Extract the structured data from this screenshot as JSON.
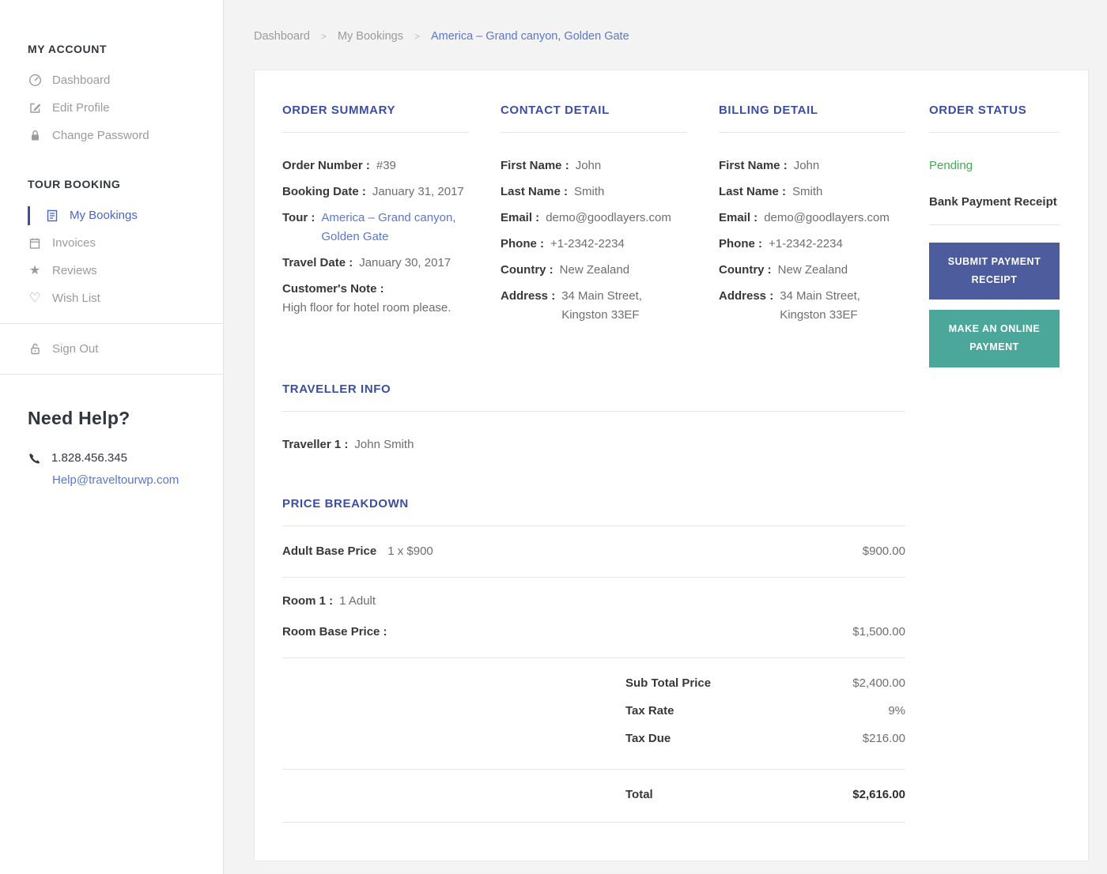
{
  "colors": {
    "heading_blue": "#3c4f9e",
    "link_blue": "#5c77ca",
    "pending_green": "#3faf4d",
    "submit_button_bg": "#4d5c9d",
    "online_button_bg": "#4ca79b"
  },
  "sidebar": {
    "account": {
      "title": "MY ACCOUNT",
      "items": [
        {
          "label": "Dashboard",
          "icon": "dashboard-icon"
        },
        {
          "label": "Edit Profile",
          "icon": "edit-icon"
        },
        {
          "label": "Change Password",
          "icon": "lock-icon"
        }
      ]
    },
    "booking": {
      "title": "TOUR BOOKING",
      "items": [
        {
          "label": "My Bookings",
          "icon": "bookings-icon",
          "active": true
        },
        {
          "label": "Invoices",
          "icon": "invoice-icon"
        },
        {
          "label": "Reviews",
          "icon": "star-icon"
        },
        {
          "label": "Wish List",
          "icon": "heart-icon"
        }
      ]
    },
    "sign_out": "Sign Out",
    "help": {
      "title": "Need Help?",
      "phone": "1.828.456.345",
      "email": "Help@traveltourwp.com"
    }
  },
  "breadcrumb": {
    "home": "Dashboard",
    "section": "My Bookings",
    "current": "America – Grand canyon, Golden Gate",
    "separator": ">"
  },
  "order_summary": {
    "title": "ORDER SUMMARY",
    "order_number_label": "Order Number :",
    "order_number": "#39",
    "booking_date_label": "Booking Date :",
    "booking_date": "January 31, 2017",
    "tour_label": "Tour :",
    "tour": "America – Grand canyon, Golden Gate",
    "travel_date_label": "Travel Date :",
    "travel_date": "January 30, 2017",
    "note_label": "Customer's Note :",
    "note": "High floor for hotel room please."
  },
  "contact_detail": {
    "title": "CONTACT DETAIL",
    "fields": [
      {
        "label": "First Name :",
        "value": "John"
      },
      {
        "label": "Last Name :",
        "value": "Smith"
      },
      {
        "label": "Email :",
        "value": "demo@goodlayers.com"
      },
      {
        "label": "Phone :",
        "value": "+1-2342-2234"
      },
      {
        "label": "Country :",
        "value": "New Zealand"
      },
      {
        "label": "Address :",
        "value": "34 Main Street, Kingston 33EF"
      }
    ]
  },
  "billing_detail": {
    "title": "BILLING DETAIL",
    "fields": [
      {
        "label": "First Name :",
        "value": "John"
      },
      {
        "label": "Last Name :",
        "value": "Smith"
      },
      {
        "label": "Email :",
        "value": "demo@goodlayers.com"
      },
      {
        "label": "Phone :",
        "value": "+1-2342-2234"
      },
      {
        "label": "Country :",
        "value": "New Zealand"
      },
      {
        "label": "Address :",
        "value": "34 Main Street, Kingston 33EF"
      }
    ]
  },
  "order_status": {
    "title": "ORDER STATUS",
    "status": "Pending",
    "receipt_title": "Bank Payment Receipt",
    "submit_button": "SUBMIT PAYMENT RECEIPT",
    "online_button": "MAKE AN ONLINE PAYMENT"
  },
  "traveller_info": {
    "title": "TRAVELLER INFO",
    "label": "Traveller 1 :",
    "value": "John Smith"
  },
  "price_breakdown": {
    "title": "PRICE BREAKDOWN",
    "adult_label": "Adult Base Price",
    "adult_detail": "1 x $900",
    "adult_amount": "$900.00",
    "room_label": "Room 1 :",
    "room_value": "1 Adult",
    "room_price_label": "Room Base Price :",
    "room_price_amount": "$1,500.00",
    "subtotal_label": "Sub Total Price",
    "subtotal_amount": "$2,400.00",
    "tax_rate_label": "Tax Rate",
    "tax_rate_amount": "9%",
    "tax_due_label": "Tax Due",
    "tax_due_amount": "$216.00",
    "total_label": "Total",
    "total_amount": "$2,616.00"
  }
}
